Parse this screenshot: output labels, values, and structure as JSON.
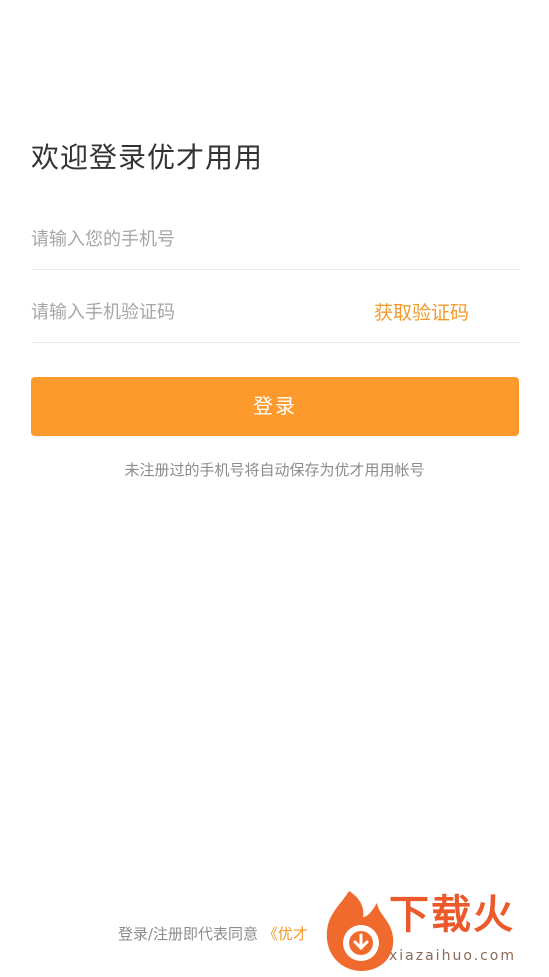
{
  "title": "欢迎登录优才用用",
  "phone_field": {
    "placeholder": "请输入您的手机号",
    "value": ""
  },
  "code_field": {
    "placeholder": "请输入手机验证码",
    "value": "",
    "get_code_label": "获取验证码"
  },
  "login_button": "登录",
  "hint": "未注册过的手机号将自动保存为优才用用帐号",
  "agreement": {
    "prefix": "登录/注册即代表同意",
    "link": "《优才"
  },
  "watermark": {
    "brand": "下载火",
    "domain": "xiazaihuo.com"
  },
  "colors": {
    "accent": "#fd9a2e",
    "link": "#f39a2b",
    "title": "#333333",
    "hint": "#8c8c8c"
  }
}
